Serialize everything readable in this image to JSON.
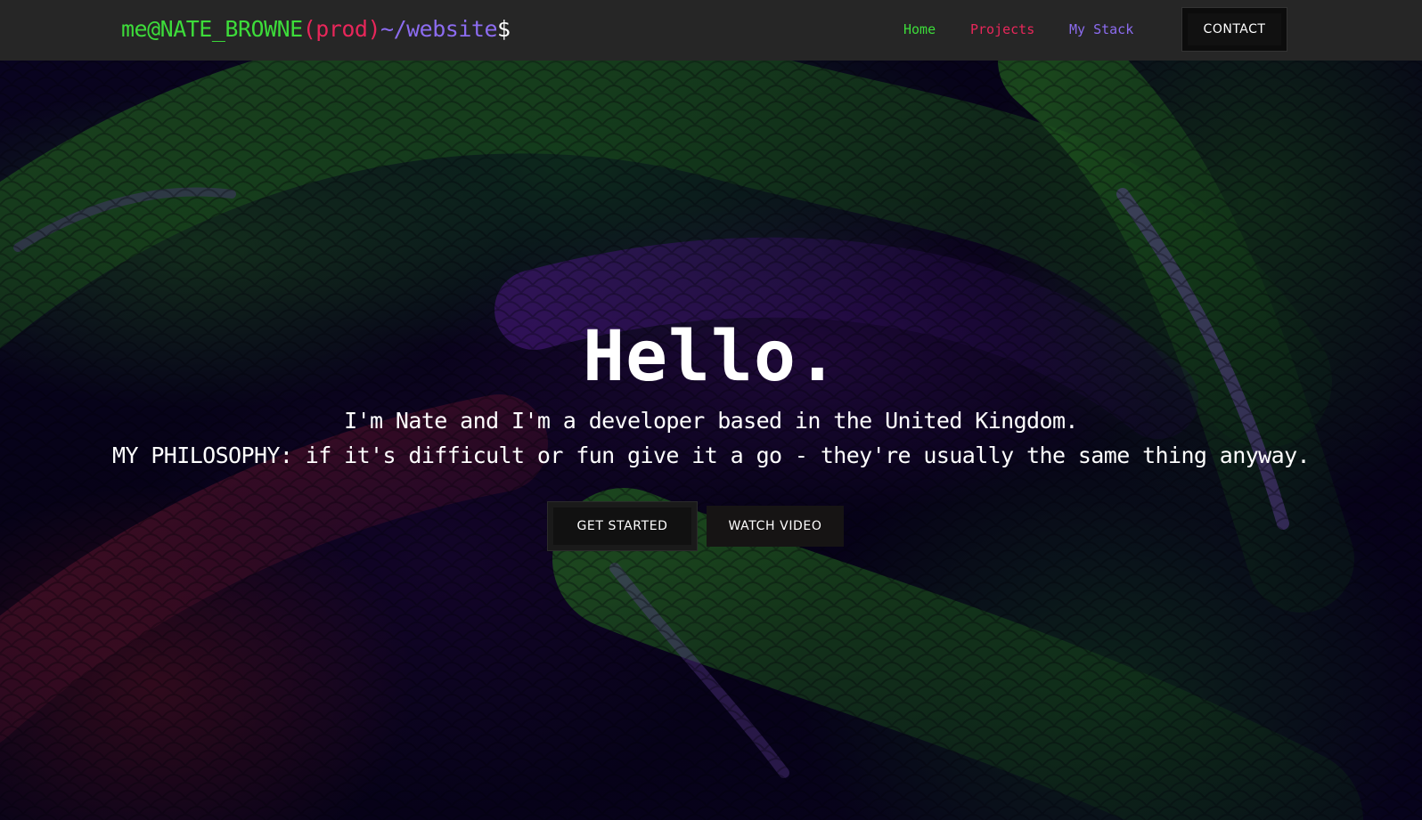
{
  "header": {
    "brand": {
      "user": "me@NATE_BROWNE",
      "env": "(prod)",
      "path": "~/website",
      "prompt": "$"
    },
    "nav": {
      "home": "Home",
      "projects": "Projects",
      "stack": "My Stack",
      "contact": "CONTACT"
    }
  },
  "hero": {
    "title": "Hello.",
    "intro": "I'm Nate and I'm a developer based in the United Kingdom.",
    "philosophy": "MY PHILOSOPHY: if it's difficult or fun give it a go - they're usually the same thing anyway.",
    "buttons": {
      "start": "GET STARTED",
      "video": "WATCH VIDEO"
    }
  },
  "colors": {
    "nav_bg": "#262626",
    "green": "#3ddc3a",
    "red": "#e8265a",
    "purple": "#8c6cf0",
    "button_bg": "#111111"
  }
}
